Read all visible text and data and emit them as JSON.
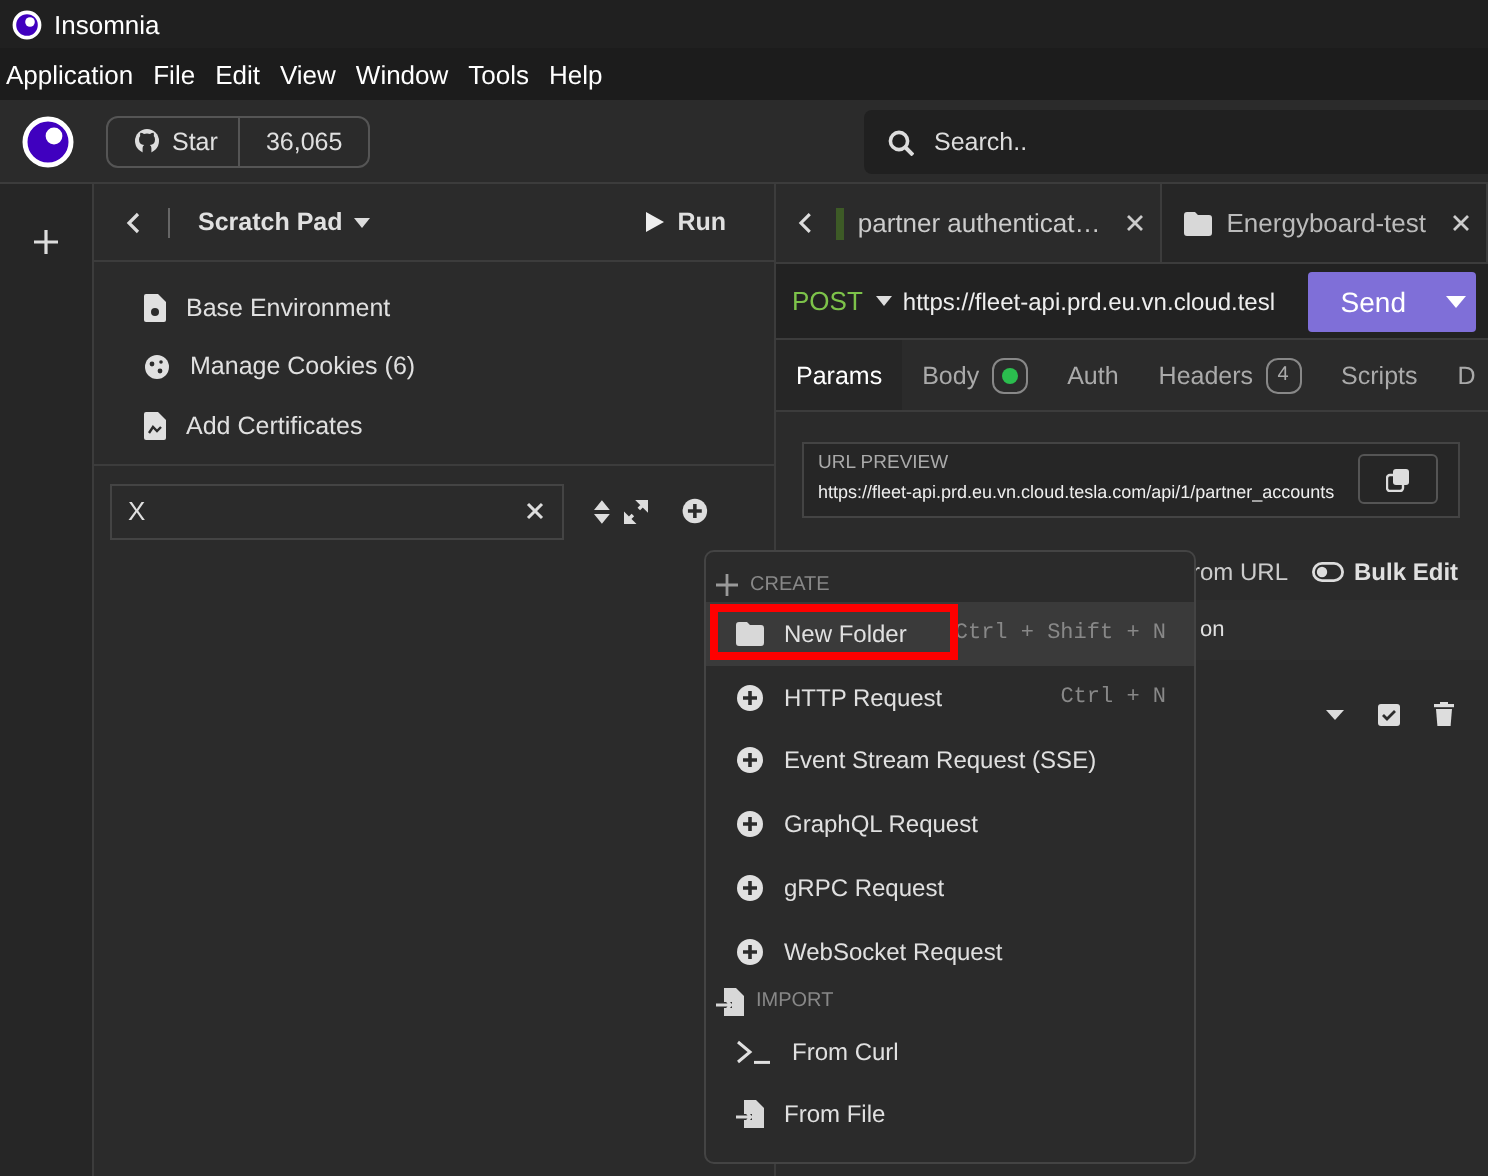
{
  "window": {
    "title": "Insomnia"
  },
  "menu_bar": [
    "Application",
    "File",
    "Edit",
    "View",
    "Window",
    "Tools",
    "Help"
  ],
  "toolbar": {
    "star_label": "Star",
    "star_count": "36,065",
    "search": {
      "placeholder": "Search.."
    }
  },
  "sidebar": {
    "title": "Scratch Pad",
    "run_label": "Run",
    "items": [
      {
        "label": "Base Environment",
        "kind": "environment"
      },
      {
        "label": "Manage Cookies (6)",
        "kind": "cookies"
      },
      {
        "label": "Add Certificates",
        "kind": "certificates"
      }
    ],
    "filter": {
      "value": "X"
    }
  },
  "request_tabs": [
    {
      "label": "partner authenticat…",
      "kind": "request",
      "selected": true
    },
    {
      "label": "Energyboard-test",
      "kind": "folder",
      "selected": false
    }
  ],
  "request": {
    "method": "POST",
    "url": "https://fleet-api.prd.eu.vn.cloud.tesl",
    "send_label": "Send"
  },
  "panel_tabs": [
    {
      "label": "Params",
      "selected": true
    },
    {
      "label": "Body",
      "has_content": true,
      "selected": false
    },
    {
      "label": "Auth",
      "selected": false
    },
    {
      "label": "Headers",
      "count": "4",
      "selected": false
    },
    {
      "label": "Scripts",
      "selected": false
    },
    {
      "label": "D",
      "selected": false
    }
  ],
  "url_preview": {
    "label": "URL PREVIEW",
    "url": "https://fleet-api.prd.eu.vn.cloud.tesla.com/api/1/partner_accounts"
  },
  "params": {
    "import_label": "rom URL",
    "bulk_edit_label": "Bulk Edit",
    "bulk_edit_on": false,
    "row_text": "on",
    "row_checked": true
  },
  "create_menu": {
    "sections": [
      {
        "title": "CREATE",
        "kind": "create",
        "items": [
          {
            "label": "New Folder",
            "kind": "folder",
            "shortcut": "Ctrl + Shift + N",
            "selected": true,
            "highlighted": true
          },
          {
            "label": "HTTP Request",
            "kind": "request",
            "shortcut": "Ctrl + N",
            "selected": false,
            "highlighted": false
          },
          {
            "label": "Event Stream Request (SSE)",
            "kind": "request",
            "selected": false,
            "highlighted": false
          },
          {
            "label": "GraphQL Request",
            "kind": "request",
            "selected": false,
            "highlighted": false
          },
          {
            "label": "gRPC Request",
            "kind": "request",
            "selected": false,
            "highlighted": false
          },
          {
            "label": "WebSocket Request",
            "kind": "request",
            "selected": false,
            "highlighted": false
          }
        ]
      },
      {
        "title": "IMPORT",
        "kind": "import",
        "items": [
          {
            "label": "From Curl",
            "kind": "curl",
            "selected": false,
            "highlighted": false
          },
          {
            "label": "From File",
            "kind": "file",
            "selected": false,
            "highlighted": false
          }
        ]
      }
    ]
  }
}
